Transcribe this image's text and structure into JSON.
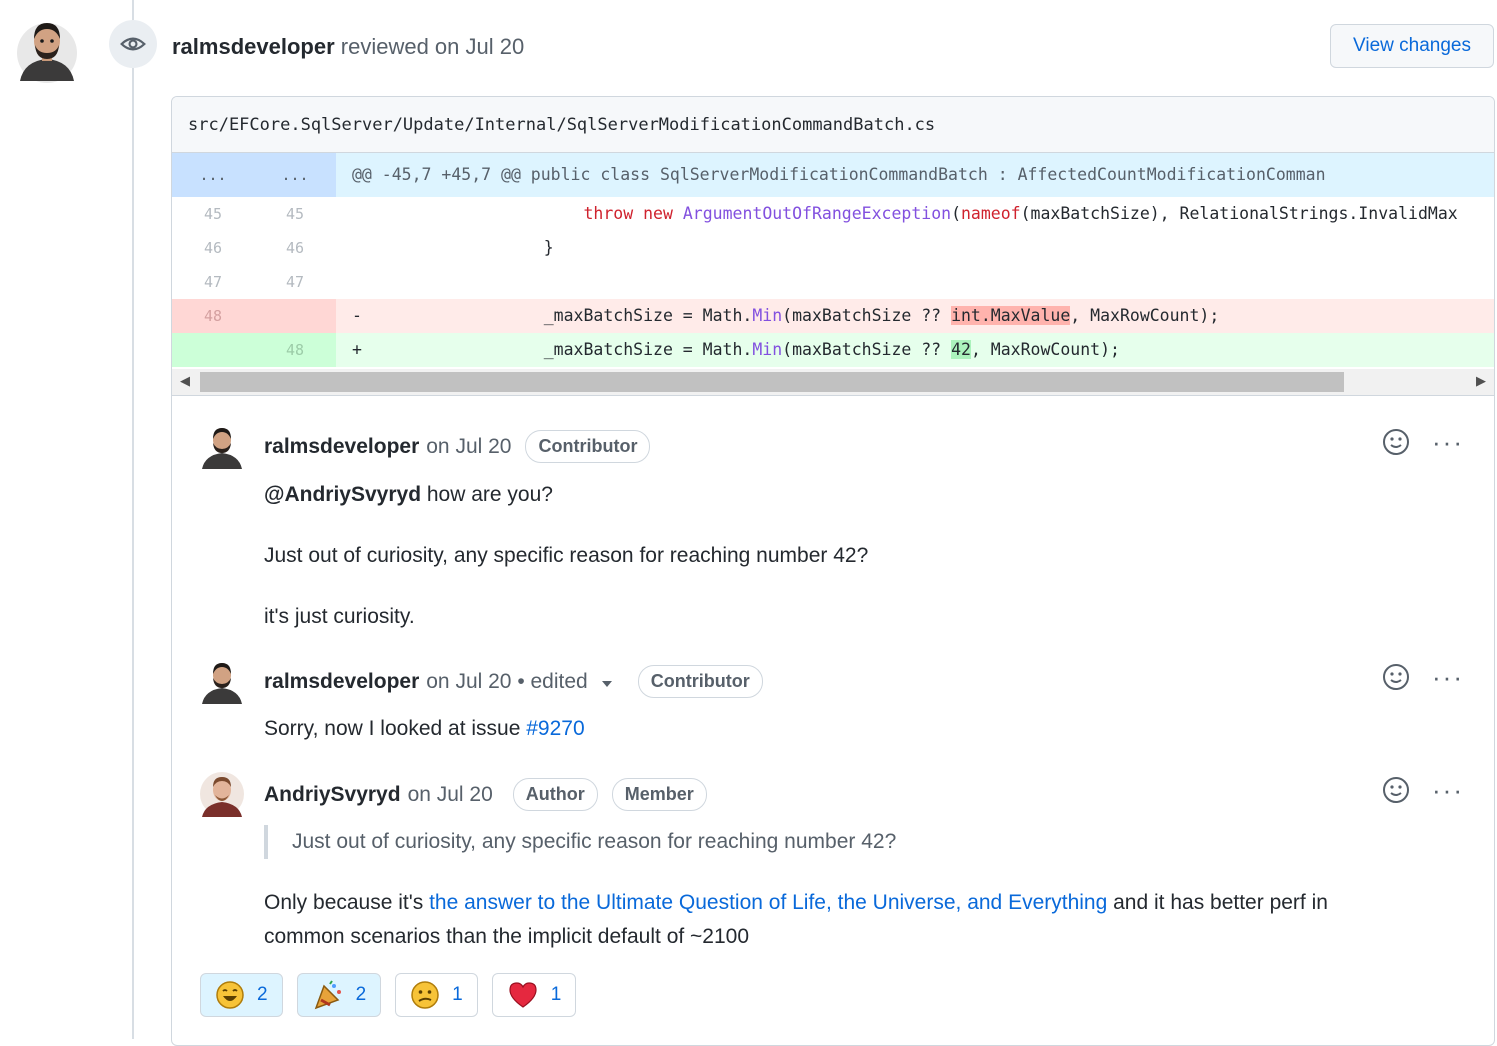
{
  "review": {
    "author": "ralmsdeveloper",
    "action": "reviewed on Jul 20",
    "view_changes": "View changes",
    "icons": {
      "eye": "eye-icon",
      "avatar": "avatar"
    }
  },
  "file": {
    "path": "src/EFCore.SqlServer/Update/Internal/SqlServerModificationCommandBatch.cs",
    "hunk": {
      "left": "...",
      "right": "...",
      "text": "@@ -45,7 +45,7 @@ public class SqlServerModificationCommandBatch : AffectedCountModificationComman"
    },
    "lines": [
      {
        "old": "45",
        "new": "45",
        "type": "context",
        "indent": "        ",
        "p1": "throw",
        "p2": " ",
        "p3": "new",
        "p4": " ",
        "p5": "ArgumentOutOfRangeException",
        "p6": "(",
        "p7": "nameof",
        "p8": "(maxBatchSize), RelationalStrings.InvalidMax"
      },
      {
        "old": "46",
        "new": "46",
        "type": "context",
        "text": "    }"
      },
      {
        "old": "47",
        "new": "47",
        "type": "context",
        "text": ""
      },
      {
        "old": "48",
        "new": "",
        "type": "deletion",
        "sign": "-",
        "pre": "    _maxBatchSize = Math.",
        "method": "Min",
        "mid": "(maxBatchSize ?? ",
        "changed": "int.MaxValue",
        "post": ", MaxRowCount);"
      },
      {
        "old": "",
        "new": "48",
        "type": "addition",
        "sign": "+",
        "pre": "    _maxBatchSize = Math.",
        "method": "Min",
        "mid": "(maxBatchSize ?? ",
        "changed": "42",
        "post": ", MaxRowCount);"
      }
    ]
  },
  "comments": [
    {
      "author": "ralmsdeveloper",
      "meta": "on Jul 20",
      "badges": [
        "Contributor"
      ],
      "mention": "@AndriySvyryd",
      "line1_rest": " how are you?",
      "line2": "Just out of curiosity, any specific reason for reaching number 42?",
      "line3": "it's just curiosity."
    },
    {
      "author": "ralmsdeveloper",
      "meta": "on Jul 20 • edited",
      "badges": [
        "Contributor"
      ],
      "text": "Sorry, now I looked at issue ",
      "link": "#9270"
    },
    {
      "author": "AndriySvyryd",
      "meta": "on Jul 20",
      "badges": [
        "Author",
        "Member"
      ],
      "quote": "Just out of curiosity, any specific reason for reaching number 42?",
      "text_pre": "Only because it's ",
      "link": "the answer to the Ultimate Question of Life, the Universe, and Everything",
      "text_post": " and it has better perf in",
      "line2": "common scenarios than the implicit default of ~2100"
    }
  ],
  "reactions": [
    {
      "icon": "laugh-emoji-icon",
      "count": "2"
    },
    {
      "icon": "hooray-emoji-icon",
      "count": "2"
    },
    {
      "icon": "confused-emoji-icon",
      "count": "1"
    },
    {
      "icon": "heart-emoji-icon",
      "count": "1"
    }
  ],
  "colors": {
    "link": "#0969da",
    "deletion_bg": "#ffebe9",
    "addition_bg": "#e6ffec",
    "hunk_bg": "#ddf4ff"
  }
}
